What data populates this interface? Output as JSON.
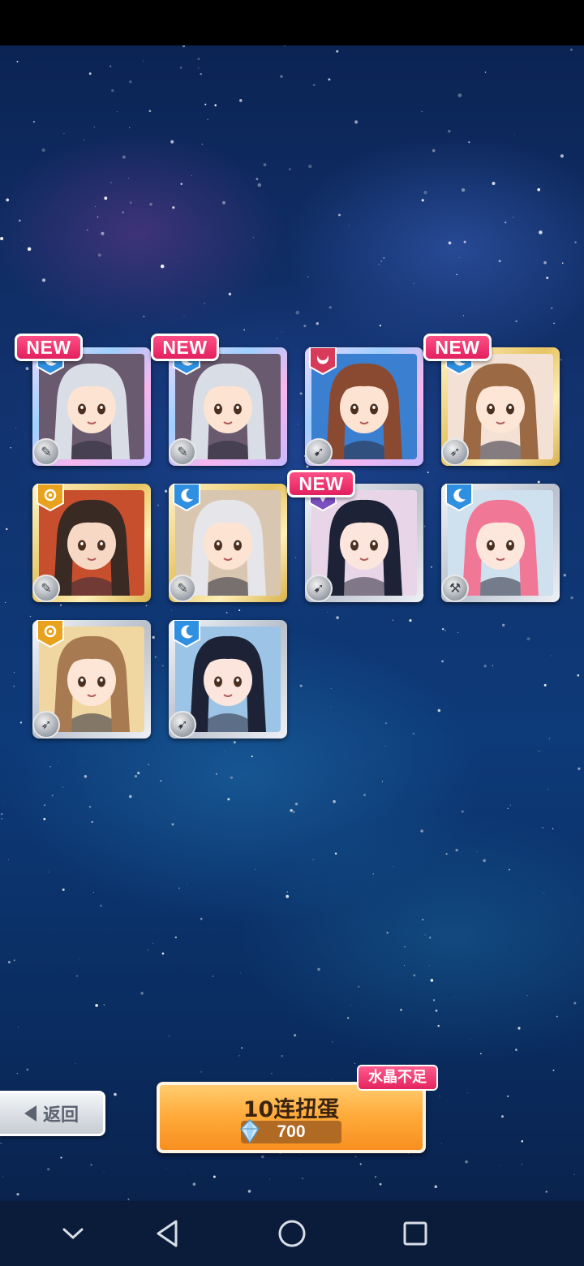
{
  "new_tag_label": "NEW",
  "cards": [
    {
      "id": 1,
      "is_new": true,
      "rarity": "rainbow",
      "attribute": "blue-moon",
      "role": "sword",
      "hair": "#d9dde6",
      "skin": "#fde3d2",
      "bg": "#6a5a70"
    },
    {
      "id": 2,
      "is_new": true,
      "rarity": "rainbow",
      "attribute": "blue-moon",
      "role": "sword",
      "hair": "#d9dde6",
      "skin": "#fde3d2",
      "bg": "#6a5a70"
    },
    {
      "id": 3,
      "is_new": false,
      "rarity": "rainbow",
      "attribute": "red-moon",
      "role": "gun",
      "hair": "#8a4a32",
      "skin": "#fde3d2",
      "bg": "#3a7fd0"
    },
    {
      "id": 4,
      "is_new": true,
      "rarity": "gold",
      "attribute": "blue-moon",
      "role": "rocket",
      "hair": "#9b6a44",
      "skin": "#fde6d6",
      "bg": "#f3e1d6"
    },
    {
      "id": 5,
      "is_new": false,
      "rarity": "gold",
      "attribute": "yellow-sun",
      "role": "sword",
      "hair": "#3a2a24",
      "skin": "#f6d8c4",
      "bg": "#c84f2e"
    },
    {
      "id": 6,
      "is_new": false,
      "rarity": "gold",
      "attribute": "blue-moon",
      "role": "sword",
      "hair": "#e6e6ea",
      "skin": "#fde3d2",
      "bg": "#d8c6b0"
    },
    {
      "id": 7,
      "is_new": true,
      "rarity": "silver",
      "attribute": "purple",
      "role": "gun",
      "hair": "#1e2236",
      "skin": "#fbe5dc",
      "bg": "#e8d6e8"
    },
    {
      "id": 8,
      "is_new": false,
      "rarity": "silver",
      "attribute": "blue-moon",
      "role": "hammer",
      "hair": "#f07896",
      "skin": "#fde6dc",
      "bg": "#cfe0ee"
    },
    {
      "id": 9,
      "is_new": false,
      "rarity": "silver",
      "attribute": "yellow-sun",
      "role": "rocket",
      "hair": "#a77a52",
      "skin": "#fde6d6",
      "bg": "#f0d6a0"
    },
    {
      "id": 10,
      "is_new": false,
      "rarity": "silver",
      "attribute": "blue-moon",
      "role": "gun",
      "hair": "#1e2236",
      "skin": "#fbe5dc",
      "bg": "#9cc4e6"
    }
  ],
  "back_button": {
    "label": "返回"
  },
  "gacha_button": {
    "label": "10连扭蛋",
    "cost": "700",
    "currency_icon": "crystal-icon"
  },
  "insufficient_tag": {
    "label": "水晶不足"
  },
  "nav": {
    "items": [
      "chevron-down-icon",
      "back-triangle-icon",
      "home-circle-icon",
      "recents-square-icon"
    ]
  },
  "colors": {
    "new_tag": "#e2205f",
    "gacha_orange": "#f78f20",
    "background": "#12326e"
  }
}
